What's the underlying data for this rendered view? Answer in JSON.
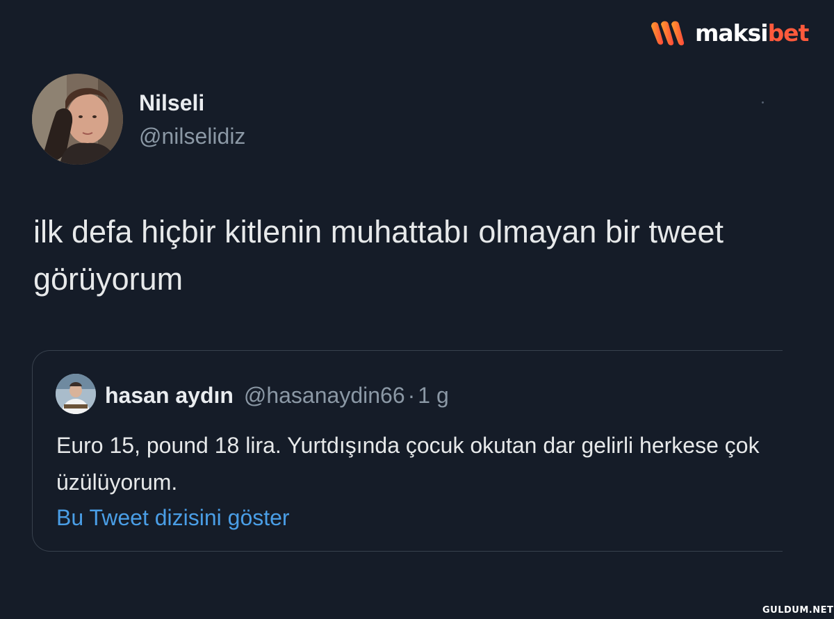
{
  "brand": {
    "name_part1": "maksi",
    "name_part2": "bet",
    "logo_icon": "maksibet-m-logo",
    "accent_color": "#ff5a3c"
  },
  "tweet": {
    "author": {
      "display_name": "Nilseli",
      "handle": "@nilselidiz",
      "avatar_icon": "profile-photo"
    },
    "text": "ilk defa hiçbir kitlenin muhattabı olmayan bir tweet görüyorum"
  },
  "quoted_tweet": {
    "author": {
      "display_name": "hasan aydın",
      "handle": "@hasanaydin66",
      "avatar_icon": "profile-photo"
    },
    "separator": "·",
    "time": "1 g",
    "text": "Euro 15, pound 18 lira. Yurtdışında çocuk okutan dar gelirli herkese çok üzülüyorum.",
    "thread_link": "Bu Tweet dizisini göster",
    "link_color": "#4a9ee6"
  },
  "watermark": "GULDUM.NET",
  "colors": {
    "background": "#151c28",
    "primary_text": "#e7e9ea",
    "secondary_text": "#8b98a5",
    "border": "#38414d"
  }
}
